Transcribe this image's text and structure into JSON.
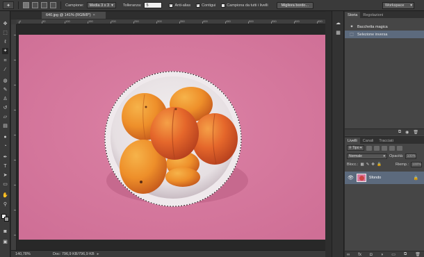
{
  "options_bar": {
    "sample_label": "Campione:",
    "sample_value": "Media 3 x 3",
    "tolerance_label": "Tolleranza:",
    "tolerance_value": "5",
    "antialias_label": "Anti-alias",
    "contiguous_label": "Contigui",
    "sample_all_label": "Campiona da tutti i livelli",
    "refine_edge_label": "Migliora bordo...",
    "workspace_label": "Workspace"
  },
  "document": {
    "tab_title": "640.jpg @ 141% (RGB/8*)",
    "close_glyph": "×",
    "zoom": "140,78%",
    "doc_size": "Doc: 796,9 KB/796,9 KB"
  },
  "ruler": {
    "h_ticks": [
      "0",
      "50",
      "100",
      "150",
      "200",
      "250",
      "300",
      "350",
      "400",
      "450",
      "500",
      "550",
      "600",
      "650"
    ],
    "v_ticks": [
      "0",
      "50",
      "100",
      "150",
      "200",
      "250",
      "300",
      "350",
      "400"
    ]
  },
  "history_panel": {
    "tabs": [
      "Storia",
      "Regolazioni"
    ],
    "items": [
      {
        "label": "Bacchetta magica",
        "icon": "magic-wand-icon",
        "selected": false
      },
      {
        "label": "Selezione inversa",
        "icon": "selection-icon",
        "selected": true
      }
    ]
  },
  "layers_panel": {
    "tabs": [
      "Livelli",
      "Canali",
      "Tracciati"
    ],
    "filter_label": "Tipo",
    "blend_mode": "Normale",
    "opacity_label": "Opacità:",
    "opacity_value": "100%",
    "lock_label": "Blocc.:",
    "fill_label": "Riemp.:",
    "fill_value": "100%",
    "layer_name": "Sfondo"
  },
  "colors": {
    "canvas_pink": "#d6799e",
    "selection_blue": "#5c6a7d",
    "chrome_dark": "#3a3a3a"
  },
  "icons": {
    "toolbar": [
      "move-icon",
      "marquee-icon",
      "lasso-icon",
      "magic-wand-icon",
      "crop-icon",
      "eyedropper-icon",
      "healing-icon",
      "brush-icon",
      "stamp-icon",
      "history-brush-icon",
      "eraser-icon",
      "gradient-icon",
      "blur-icon",
      "dodge-icon",
      "pen-icon",
      "type-icon",
      "path-select-icon",
      "shape-icon",
      "hand-icon",
      "zoom-icon"
    ]
  }
}
